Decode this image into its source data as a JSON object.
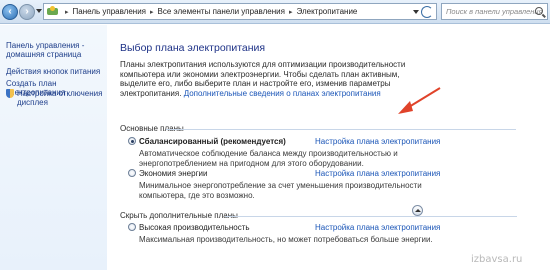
{
  "address_bar": {
    "breadcrumbs": [
      "Панель управления",
      "Все элементы панели управления",
      "Электропитание"
    ],
    "search_placeholder": "Поиск в панели управления"
  },
  "sidebar": {
    "home": "Панель управления - домашняя страница",
    "items": [
      {
        "label": "Действия кнопок питания"
      },
      {
        "label": "Создать план электропитания"
      },
      {
        "label": "Настройка отключения дисплея"
      }
    ]
  },
  "main": {
    "title": "Выбор плана электропитания",
    "intro": "Планы электропитания используются для оптимизации производительности компьютера или экономии электроэнергии. Чтобы сделать план активным, выделите его, либо выберите план и настройте его, изменив параметры электропитания.",
    "intro_link": "Дополнительные сведения о планах электропитания",
    "section_main": "Основные планы",
    "section_hidden": "Скрыть дополнительные планы",
    "plans": [
      {
        "name": "Сбалансированный (рекомендуется)",
        "link": "Настройка плана электропитания",
        "desc": "Автоматическое соблюдение баланса между производительностью и энергопотреблением на пригодном для этого оборудовании.",
        "selected": true
      },
      {
        "name": "Экономия энергии",
        "link": "Настройка плана электропитания",
        "desc": "Минимальное энергопотребление за счет уменьшения производительности компьютера, где это возможно.",
        "selected": false
      },
      {
        "name": "Высокая производительность",
        "link": "Настройка плана электропитания",
        "desc": "Максимальная производительность, но может потребоваться больше энергии.",
        "selected": false
      }
    ]
  },
  "watermark": "izbavsa.ru",
  "colors": {
    "arrow": "#e0432a",
    "link": "#1a55b7",
    "title": "#1e3287"
  }
}
